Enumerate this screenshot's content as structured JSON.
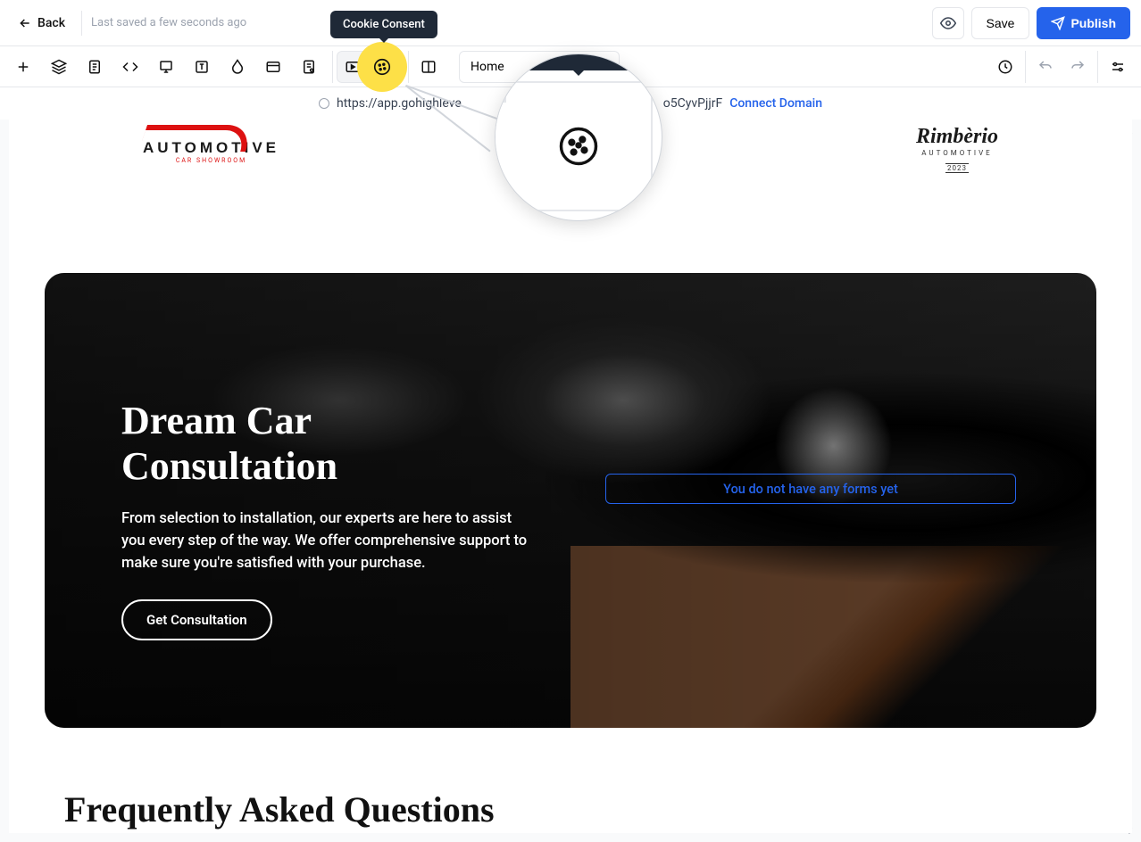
{
  "header": {
    "back_label": "Back",
    "save_status": "Last saved a few seconds ago",
    "save_label": "Save",
    "publish_label": "Publish"
  },
  "tooltip": {
    "cookie_consent": "Cookie Consent"
  },
  "toolbar": {
    "page_label": "Home"
  },
  "urlbar": {
    "url_left": "https://app.gohighleve",
    "url_right": "o5CyvPjjrF",
    "connect_label": "Connect Domain"
  },
  "canvas": {
    "logo_left_t1": "AUTOMOTIVE",
    "logo_left_t2": "CAR SHOWROOM",
    "logo_right_t1": "Rimbèrio",
    "logo_right_t2": "AUTOMOTIVE",
    "logo_right_t3": "2023",
    "hero_title": "Dream Car Consultation",
    "hero_body": "From selection to installation, our experts are here to assist you every step of the way. We offer comprehensive support to make sure you're satisfied with your purchase.",
    "hero_cta": "Get Consultation",
    "form_placeholder": "You do not have any forms yet",
    "faq_title": "Frequently Asked Questions"
  }
}
